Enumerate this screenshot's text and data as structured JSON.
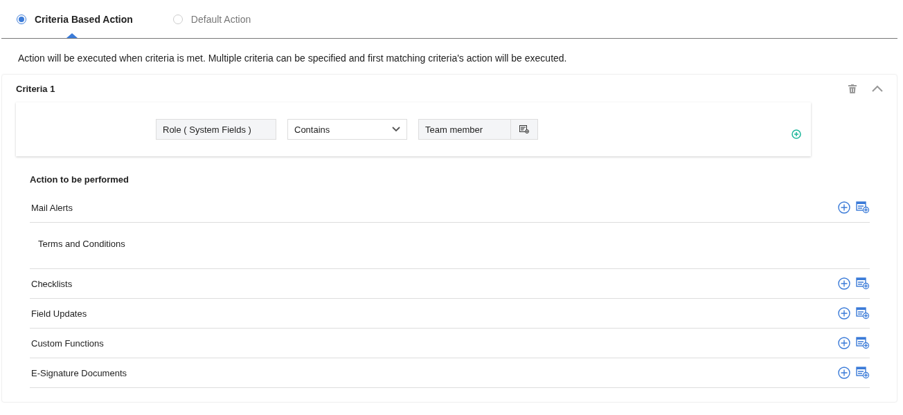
{
  "action_types": [
    {
      "label": "Criteria Based Action",
      "selected": true
    },
    {
      "label": "Default Action",
      "selected": false
    }
  ],
  "description": "Action will be executed when criteria is met. Multiple criteria can be specified and first matching criteria's action will be executed.",
  "criteria": {
    "title": "Criteria 1",
    "expanded": true,
    "field": "Role ( System Fields )",
    "operator": "Contains",
    "value": "Team member"
  },
  "actions_heading": "Action to be performed",
  "action_sections": [
    {
      "title": "Mail Alerts",
      "items": [
        "Terms and Conditions"
      ]
    },
    {
      "title": "Checklists"
    },
    {
      "title": "Field Updates"
    },
    {
      "title": "Custom Functions"
    },
    {
      "title": "E-Signature Documents"
    }
  ]
}
